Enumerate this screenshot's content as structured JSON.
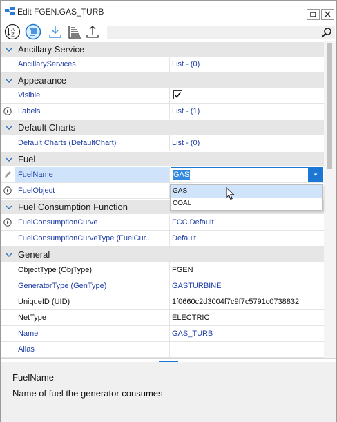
{
  "window": {
    "title": "Edit FGEN.GAS_TURB"
  },
  "toolbar": {
    "buttons": [
      "sort-alphabetical",
      "sort-categorized",
      "expand-all",
      "collapse-all",
      "export"
    ],
    "search": {
      "value": "",
      "placeholder": ""
    }
  },
  "sections": [
    {
      "name": "Ancillary Service"
    },
    {
      "name": "Appearance"
    },
    {
      "name": "Default Charts"
    },
    {
      "name": "Fuel"
    },
    {
      "name": "Fuel Consumption Function"
    },
    {
      "name": "General"
    }
  ],
  "rows": {
    "ancillary_services": {
      "name": "AncillaryServices",
      "value": "List - (0)"
    },
    "visible": {
      "name": "Visible",
      "checked": true
    },
    "labels": {
      "name": "Labels",
      "value": "List - (1)"
    },
    "default_charts": {
      "name": "Default Charts (DefaultChart)",
      "value": "List - (0)"
    },
    "fuel_name": {
      "name": "FuelName",
      "value": "GAS"
    },
    "fuel_object": {
      "name": "FuelObject",
      "value": ""
    },
    "fuel_consumption_curve": {
      "name": "FuelConsumptionCurve",
      "value": "FCC.Default"
    },
    "fuel_consumption_curve_type": {
      "name": "FuelConsumptionCurveType (FuelCur...",
      "value": "Default"
    },
    "object_type": {
      "name": "ObjectType (ObjType)",
      "value": "FGEN"
    },
    "generator_type": {
      "name": "GeneratorType (GenType)",
      "value": "GASTURBINE"
    },
    "unique_id": {
      "name": "UniqueID (UID)",
      "value": "1f0660c2d3004f7c9f7c5791c0738832"
    },
    "net_type": {
      "name": "NetType",
      "value": "ELECTRIC"
    },
    "name": {
      "name": "Name",
      "value": "GAS_TURB"
    },
    "alias": {
      "name": "Alias",
      "value": ""
    }
  },
  "dropdown": {
    "options": [
      "GAS",
      "COAL"
    ],
    "hovered": "GAS"
  },
  "description": {
    "title": "FuelName",
    "text": "Name of fuel the generator consumes"
  },
  "colors": {
    "accent": "#1c77d4",
    "link": "#1f3fa8",
    "section_bg": "#e6e6e6",
    "selection": "#cfe4fa"
  }
}
